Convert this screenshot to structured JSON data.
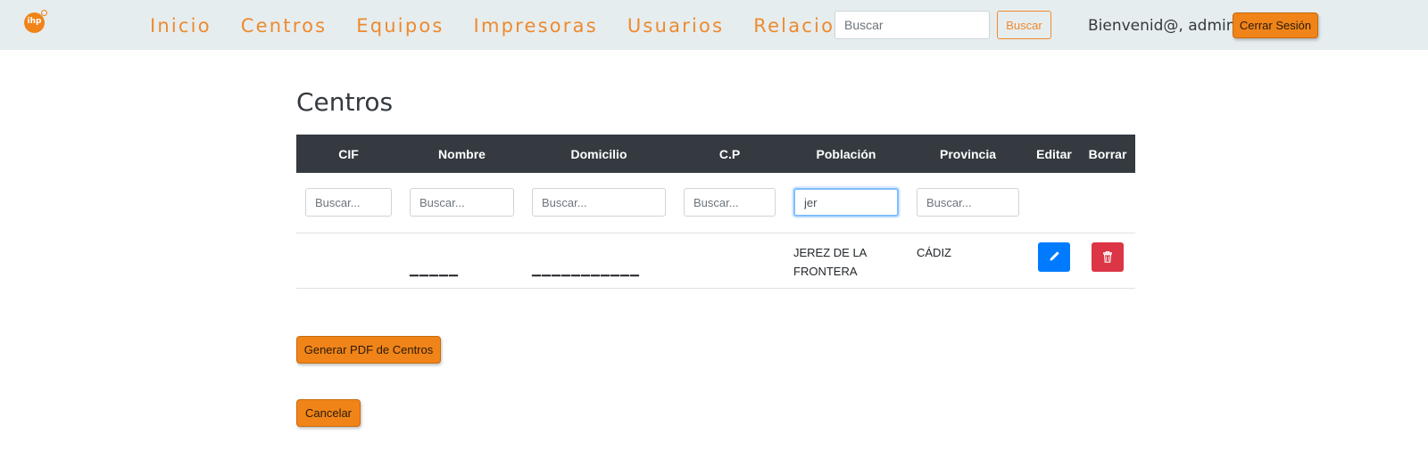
{
  "colors": {
    "accent": "#f08419",
    "nav_link": "#ee8a2d",
    "navbar_bg": "#e6edef",
    "table_header_bg": "#343a40",
    "edit_button": "#007bff",
    "delete_button": "#dc3545"
  },
  "navbar": {
    "logo_text": "ihp",
    "links": [
      "Inicio",
      "Centros",
      "Equipos",
      "Impresoras",
      "Usuarios",
      "Relaciones"
    ],
    "search_placeholder": "Buscar",
    "search_button": "Buscar",
    "welcome": "Bienvenid@, admin",
    "logout_button": "Cerrar Sesión"
  },
  "page": {
    "title": "Centros"
  },
  "table": {
    "columns": [
      "CIF",
      "Nombre",
      "Domicilio",
      "C.P",
      "Población",
      "Provincia",
      "Editar",
      "Borrar"
    ],
    "filters": [
      {
        "placeholder": "Buscar...",
        "value": ""
      },
      {
        "placeholder": "Buscar...",
        "value": ""
      },
      {
        "placeholder": "Buscar...",
        "value": ""
      },
      {
        "placeholder": "Buscar...",
        "value": ""
      },
      {
        "placeholder": "Buscar...",
        "value": "jer"
      },
      {
        "placeholder": "Buscar...",
        "value": ""
      }
    ],
    "rows": [
      {
        "cif": "",
        "nombre": "▁▁▁▁▁",
        "domicilio": "▁▁▁▁▁▁▁▁▁▁▁",
        "cp": "",
        "poblacion": "JEREZ DE LA FRONTERA",
        "provincia": "CÁDIZ",
        "edit_icon": "pencil-icon",
        "delete_icon": "trash-icon"
      }
    ]
  },
  "actions": {
    "pdf_button": "Generar PDF de Centros",
    "cancel_button": "Cancelar"
  }
}
